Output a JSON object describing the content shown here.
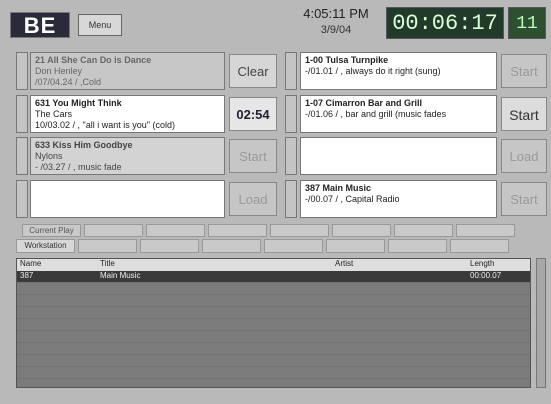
{
  "header": {
    "logo": "BE",
    "menu_label": "Menu",
    "clock": "4:05:11 PM",
    "date": "3/9/04",
    "timer": "00:06:17",
    "cart_indicator": "11"
  },
  "left_slots": [
    {
      "line1": "21  All She Can Do is Dance",
      "line2": "Don Henley",
      "line3": "  /07/04.24 / ,Cold",
      "style": "dim"
    },
    {
      "line1": "631  You Might Think",
      "line2": "The Cars",
      "line3": "10/03.02 / , \"all i want is you\" (cold)",
      "style": "live"
    },
    {
      "line1": "633  Kiss Him Goodbye",
      "line2": "Nylons",
      "line3": "  - /03.27 / ,  music fade",
      "style": "dim2"
    },
    {
      "line1": "",
      "line2": "",
      "line3": "",
      "style": "live"
    }
  ],
  "left_buttons": [
    {
      "label": "Clear",
      "style": "active"
    },
    {
      "label": "02:54",
      "style": "countdown"
    },
    {
      "label": "Start",
      "style": ""
    },
    {
      "label": "Load",
      "style": ""
    }
  ],
  "right_slots": [
    {
      "line1": "1-00  Tulsa Turnpike",
      "line2": "",
      "line3": "  -/01.01 / ,  always do it right (sung)"
    },
    {
      "line1": "1-07  Cimarron Bar and Grill",
      "line2": "",
      "line3": "  -/01.06 / ,  bar and grill (music fades"
    },
    {
      "line1": "",
      "line2": "",
      "line3": ""
    },
    {
      "line1": "387  Main Music",
      "line2": "",
      "line3": "  -/00.07 / ,  Capital Radio"
    }
  ],
  "right_buttons": [
    {
      "label": "Start",
      "style": ""
    },
    {
      "label": "Start",
      "style": "start-active"
    },
    {
      "label": "Load",
      "style": ""
    },
    {
      "label": "Start",
      "style": ""
    }
  ],
  "tabs_row1": [
    "Current Play",
    "",
    "",
    "",
    "",
    "",
    "",
    ""
  ],
  "tabs_row2": [
    "Workstation",
    "",
    "",
    "",
    "",
    "",
    "",
    ""
  ],
  "table": {
    "columns": [
      "Name",
      "Title",
      "Artist",
      "Length"
    ],
    "rows": [
      [
        "387",
        "Main Music",
        "",
        "00:00.07"
      ],
      [
        "",
        "",
        "",
        ""
      ],
      [
        "",
        "",
        "",
        ""
      ],
      [
        "",
        "",
        "",
        ""
      ],
      [
        "",
        "",
        "",
        ""
      ],
      [
        "",
        "",
        "",
        ""
      ],
      [
        "",
        "",
        "",
        ""
      ],
      [
        "",
        "",
        "",
        ""
      ],
      [
        "",
        "",
        "",
        ""
      ],
      [
        "",
        "",
        "",
        ""
      ]
    ]
  }
}
